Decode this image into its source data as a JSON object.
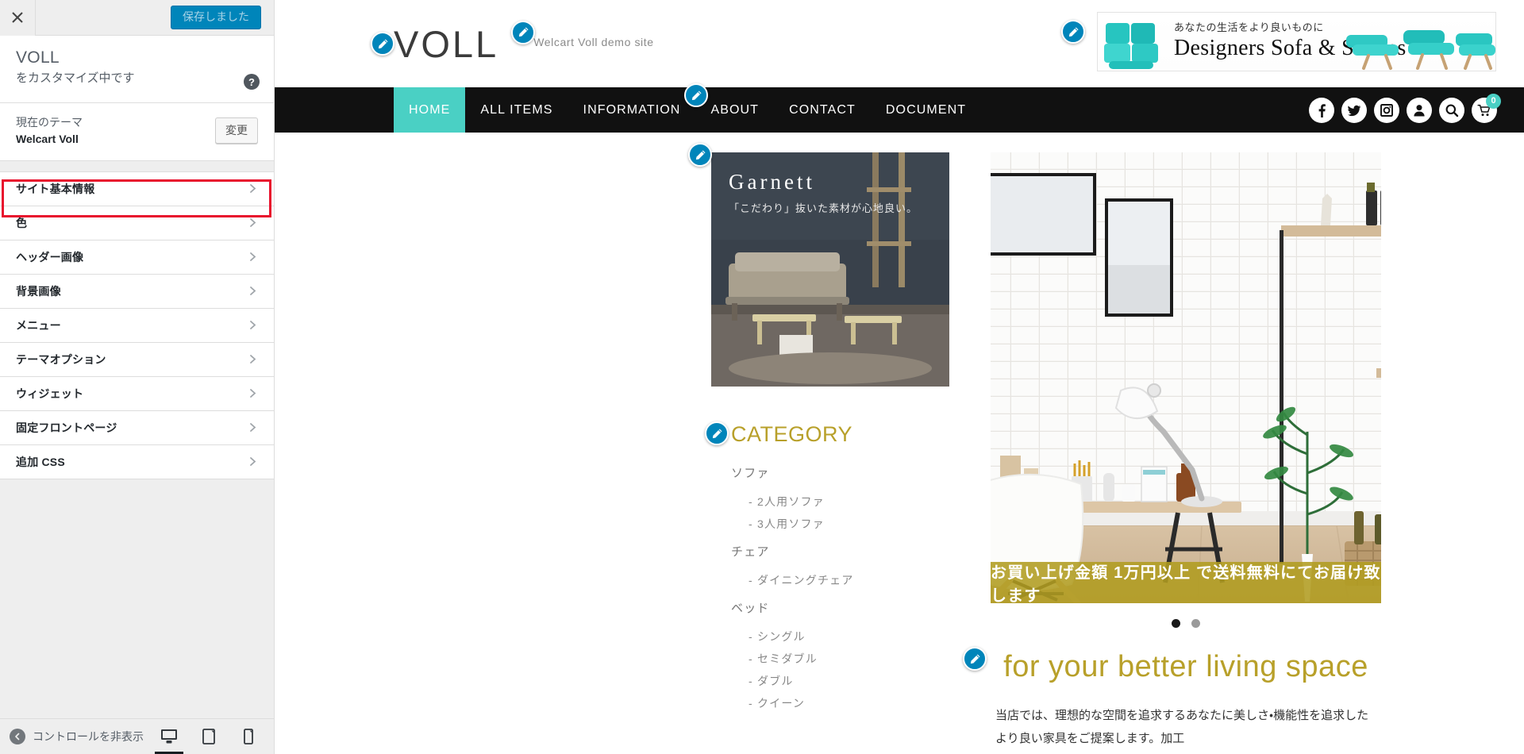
{
  "customizer": {
    "close_label": "×",
    "save_label": "保存しました",
    "title": "VOLL",
    "subtitle": "をカスタマイズ中です",
    "help_label": "?",
    "theme": {
      "label": "現在のテーマ",
      "name": "Welcart Voll",
      "change_button": "変更"
    },
    "sections": [
      {
        "label": "サイト基本情報",
        "highlighted": true
      },
      {
        "label": "色",
        "highlighted": false
      },
      {
        "label": "ヘッダー画像",
        "highlighted": false
      },
      {
        "label": "背景画像",
        "highlighted": false
      },
      {
        "label": "メニュー",
        "highlighted": false
      },
      {
        "label": "テーマオプション",
        "highlighted": false
      },
      {
        "label": "ウィジェット",
        "highlighted": false
      },
      {
        "label": "固定フロントページ",
        "highlighted": false
      },
      {
        "label": "追加 CSS",
        "highlighted": false
      }
    ],
    "footer": {
      "collapse_label": "コントロールを非表示",
      "devices": [
        {
          "name": "desktop",
          "active": true
        },
        {
          "name": "tablet",
          "active": false
        },
        {
          "name": "mobile",
          "active": false
        }
      ]
    },
    "highlight_color": "#e8112d"
  },
  "preview": {
    "header": {
      "logo": "VOLL",
      "tagline": "Welcart Voll demo site",
      "banner": {
        "sub": "あなたの生活をより良いものに",
        "title": "Designers Sofa & Settees"
      }
    },
    "nav": {
      "items": [
        {
          "label": "HOME",
          "active": true
        },
        {
          "label": "ALL ITEMS",
          "active": false
        },
        {
          "label": "INFORMATION",
          "active": false
        },
        {
          "label": "ABOUT",
          "active": false
        },
        {
          "label": "CONTACT",
          "active": false
        },
        {
          "label": "DOCUMENT",
          "active": false
        }
      ],
      "icons": [
        "facebook-icon",
        "twitter-icon",
        "instagram-icon",
        "account-icon",
        "search-icon",
        "cart-icon"
      ],
      "cart_count": "0",
      "accent_color": "#4ad0c4"
    },
    "promo": {
      "title": "Garnett",
      "subtitle": "「こだわり」抜いた素材が心地良い。"
    },
    "category": {
      "heading": "CATEGORY",
      "groups": [
        {
          "parent": "ソファ",
          "children": [
            "- 2人用ソファ",
            "- 3人用ソファ"
          ]
        },
        {
          "parent": "チェア",
          "children": [
            "- ダイニングチェア"
          ]
        },
        {
          "parent": "ベッド",
          "children": [
            "- シングル",
            "- セミダブル",
            "- ダブル",
            "- クイーン"
          ]
        }
      ]
    },
    "hero": {
      "sale_text": "お買い上げ金額 1万円以上 で送料無料にてお届け致します",
      "dots": [
        {
          "active": true
        },
        {
          "active": false
        }
      ]
    },
    "living": {
      "title": "for your better living space",
      "body": "当店では、理想的な空間を追求するあなたに美しさ・機能性を追求したより良い家具をご提案します。加工"
    }
  }
}
